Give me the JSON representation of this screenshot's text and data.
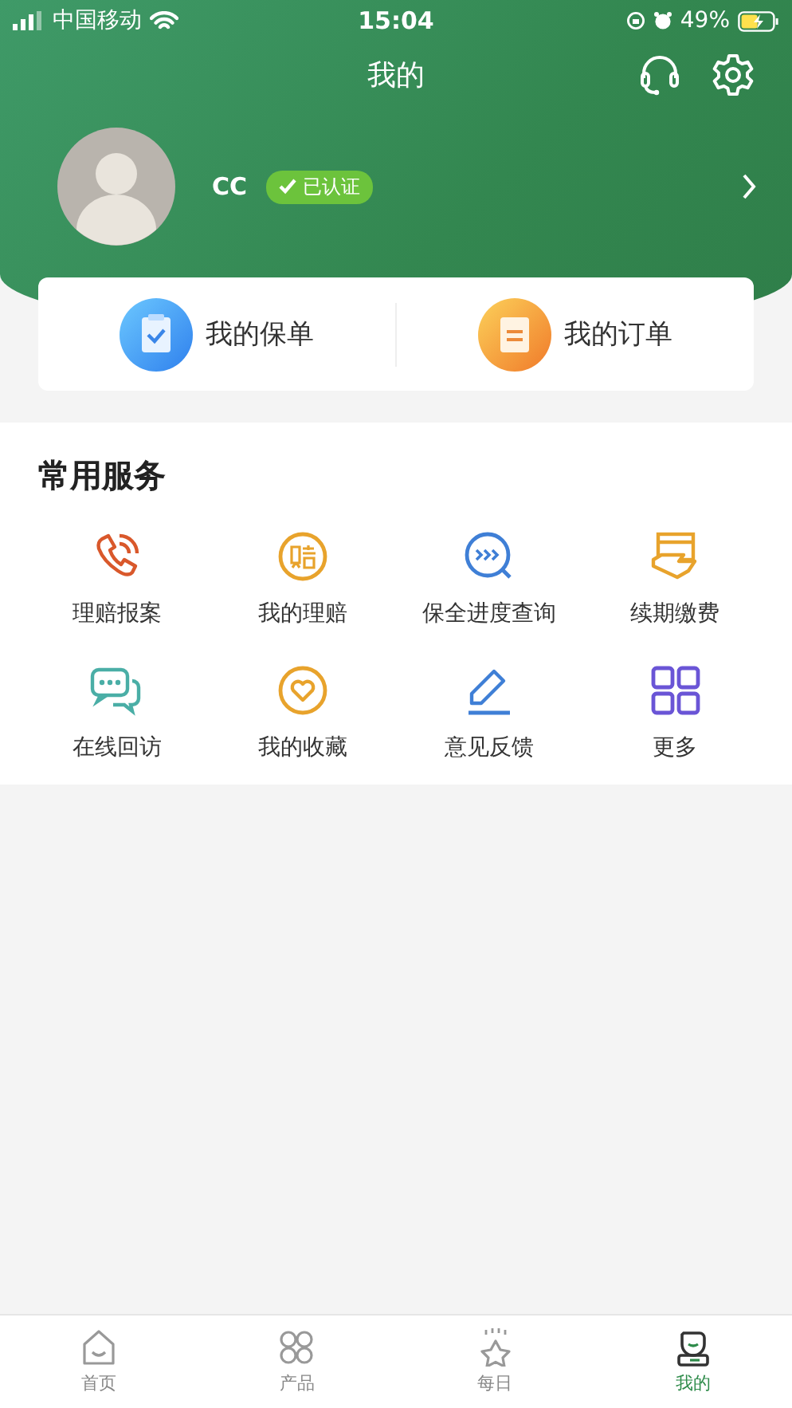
{
  "status_bar": {
    "carrier": "中国移动",
    "time": "15:04",
    "battery": "49%"
  },
  "header": {
    "title": "我的"
  },
  "profile": {
    "name": "CC",
    "badge": "已认证"
  },
  "shortcuts": [
    {
      "label": "我的保单"
    },
    {
      "label": "我的订单"
    }
  ],
  "services": {
    "title": "常用服务",
    "items": [
      {
        "label": "理赔报案"
      },
      {
        "label": "我的理赔"
      },
      {
        "label": "保全进度查询"
      },
      {
        "label": "续期缴费"
      },
      {
        "label": "在线回访"
      },
      {
        "label": "我的收藏"
      },
      {
        "label": "意见反馈"
      },
      {
        "label": "更多"
      }
    ]
  },
  "tabs": [
    {
      "label": "首页",
      "selected": false
    },
    {
      "label": "产品",
      "selected": false
    },
    {
      "label": "每日",
      "selected": false
    },
    {
      "label": "我的",
      "selected": true
    }
  ]
}
